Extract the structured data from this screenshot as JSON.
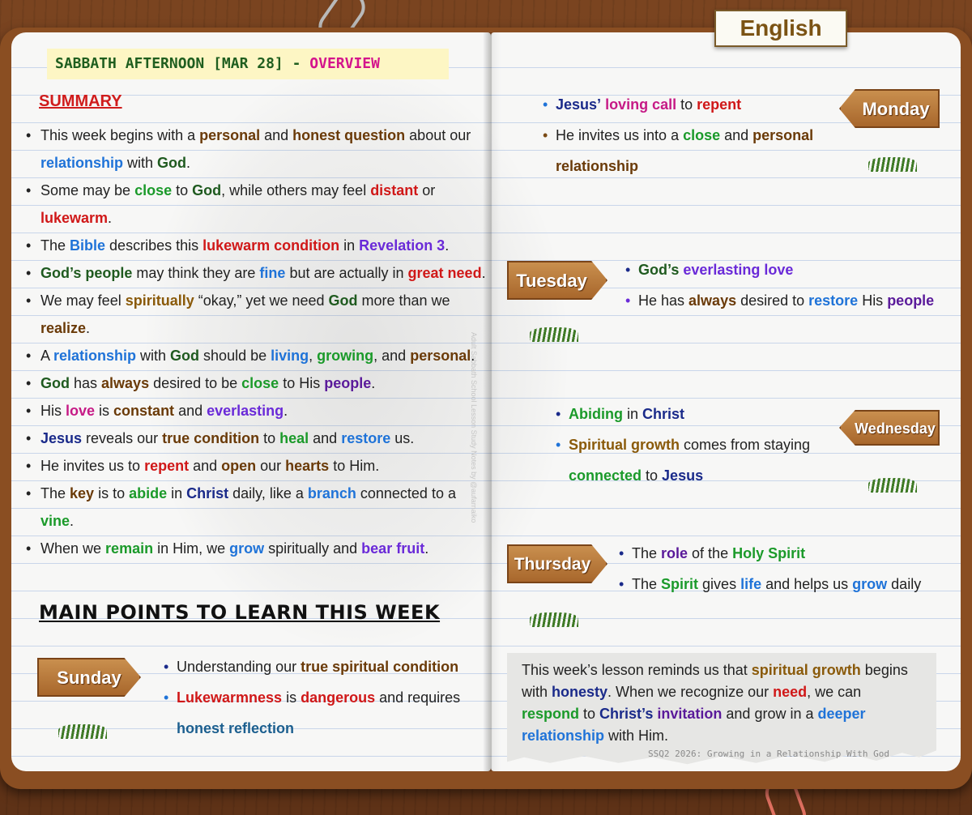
{
  "language_tab": "English",
  "header": {
    "part1": "SABBATH AFTERNOON [MAR 28] - ",
    "part2": "OVERVIEW"
  },
  "summary": {
    "title": "SUMMARY",
    "items": [
      [
        "This week begins with a ",
        {
          "t": "personal",
          "c": "brown"
        },
        " and ",
        {
          "t": "honest question",
          "c": "brown"
        },
        " about our ",
        {
          "t": "relationship",
          "c": "blue"
        },
        " with ",
        {
          "t": "God",
          "c": "dgreen"
        },
        "."
      ],
      [
        "Some may be ",
        {
          "t": "close",
          "c": "green"
        },
        " to ",
        {
          "t": "God",
          "c": "dgreen"
        },
        ", while others may feel ",
        {
          "t": "distant",
          "c": "red"
        },
        " or ",
        {
          "t": "lukewarm",
          "c": "red"
        },
        "."
      ],
      [
        "The ",
        {
          "t": "Bible",
          "c": "blue"
        },
        " describes this ",
        {
          "t": "lukewarm condition",
          "c": "red"
        },
        " in ",
        {
          "t": "Revelation 3",
          "c": "purple"
        },
        "."
      ],
      [
        {
          "t": "God’s people",
          "c": "dgreen"
        },
        " may think they are ",
        {
          "t": "fine",
          "c": "blue"
        },
        " but are actually in ",
        {
          "t": "great need",
          "c": "red"
        },
        "."
      ],
      [
        "We may feel ",
        {
          "t": "spiritually",
          "c": "gold"
        },
        " “okay,” yet we need ",
        {
          "t": "God",
          "c": "dgreen"
        },
        " more than we ",
        {
          "t": "realize",
          "c": "brown"
        },
        "."
      ],
      [
        "A ",
        {
          "t": "relationship",
          "c": "blue"
        },
        " with ",
        {
          "t": "God",
          "c": "dgreen"
        },
        " should be ",
        {
          "t": "living",
          "c": "blue"
        },
        ", ",
        {
          "t": "growing",
          "c": "green"
        },
        ", and ",
        {
          "t": "personal",
          "c": "brown"
        },
        "."
      ],
      [
        {
          "t": "God",
          "c": "dgreen"
        },
        " has ",
        {
          "t": "always",
          "c": "brown"
        },
        " desired to be ",
        {
          "t": "close",
          "c": "green"
        },
        " to His ",
        {
          "t": "people",
          "c": "dpurple"
        },
        "."
      ],
      [
        "His ",
        {
          "t": "love",
          "c": "magenta"
        },
        " is ",
        {
          "t": "constant",
          "c": "brown"
        },
        " and ",
        {
          "t": "everlasting",
          "c": "purple"
        },
        "."
      ],
      [
        {
          "t": "Jesus",
          "c": "navy"
        },
        " reveals our ",
        {
          "t": "true condition",
          "c": "brown"
        },
        " to ",
        {
          "t": "heal",
          "c": "green"
        },
        " and ",
        {
          "t": "restore",
          "c": "blue"
        },
        " us."
      ],
      [
        "He invites us to ",
        {
          "t": "repent",
          "c": "red"
        },
        " and ",
        {
          "t": "open",
          "c": "brown"
        },
        " our ",
        {
          "t": "hearts",
          "c": "brown"
        },
        " to Him."
      ],
      [
        "The ",
        {
          "t": "key",
          "c": "brown"
        },
        " is to ",
        {
          "t": "abide",
          "c": "green"
        },
        " in ",
        {
          "t": "Christ",
          "c": "navy"
        },
        " daily, like a ",
        {
          "t": "branch",
          "c": "blue"
        },
        " connected to a ",
        {
          "t": "vine",
          "c": "green"
        },
        "."
      ],
      [
        "When we ",
        {
          "t": "remain",
          "c": "green"
        },
        " in Him, we ",
        {
          "t": "grow",
          "c": "blue"
        },
        " spiritually and ",
        {
          "t": "bear fruit",
          "c": "purple"
        },
        "."
      ]
    ]
  },
  "main_points_title": "MAIN POINTS TO LEARN THIS WEEK",
  "days": {
    "sunday": {
      "label": "Sunday",
      "items": [
        {
          "bullet": "navy",
          "parts": [
            "Understanding our ",
            {
              "t": "true spiritual condition",
              "c": "brown"
            }
          ]
        },
        {
          "bullet": "blue",
          "parts": [
            {
              "t": "Lukewarmness",
              "c": "red"
            },
            " is ",
            {
              "t": "dangerous",
              "c": "red"
            },
            " and requires ",
            {
              "t": "honest reflection",
              "c": "teal"
            }
          ]
        }
      ]
    },
    "monday": {
      "label": "Monday",
      "items": [
        {
          "bullet": "blue",
          "parts": [
            {
              "t": "Jesus’",
              "c": "navy"
            },
            " ",
            {
              "t": "loving call",
              "c": "magenta"
            },
            " to ",
            {
              "t": "repent",
              "c": "red"
            }
          ]
        },
        {
          "bullet": "brown",
          "parts": [
            "He invites us into a ",
            {
              "t": "close",
              "c": "green"
            },
            " and ",
            {
              "t": "personal relationship",
              "c": "brown"
            }
          ]
        }
      ]
    },
    "tuesday": {
      "label": "Tuesday",
      "items": [
        {
          "bullet": "navy",
          "parts": [
            {
              "t": "God’s",
              "c": "dgreen"
            },
            " ",
            {
              "t": "everlasting love",
              "c": "purple"
            }
          ]
        },
        {
          "bullet": "purple",
          "parts": [
            "He has ",
            {
              "t": "always",
              "c": "brown"
            },
            " desired to ",
            {
              "t": "restore",
              "c": "blue"
            },
            " His ",
            {
              "t": "people",
              "c": "dpurple"
            }
          ]
        }
      ]
    },
    "wednesday": {
      "label": "Wednesday",
      "items": [
        {
          "bullet": "navy",
          "parts": [
            {
              "t": "Abiding",
              "c": "green"
            },
            " in ",
            {
              "t": "Christ",
              "c": "navy"
            }
          ]
        },
        {
          "bullet": "blue",
          "parts": [
            {
              "t": "Spiritual growth",
              "c": "gold"
            },
            " comes from staying ",
            {
              "t": "connected",
              "c": "green"
            },
            " to ",
            {
              "t": "Jesus",
              "c": "navy"
            }
          ]
        }
      ]
    },
    "thursday": {
      "label": "Thursday",
      "items": [
        {
          "bullet": "navy",
          "parts": [
            "The ",
            {
              "t": "role",
              "c": "dpurple"
            },
            " of the ",
            {
              "t": "Holy Spirit",
              "c": "green"
            }
          ]
        },
        {
          "bullet": "navy",
          "parts": [
            "The ",
            {
              "t": "Spirit",
              "c": "green"
            },
            " gives ",
            {
              "t": "life",
              "c": "blue"
            },
            " and helps us ",
            {
              "t": "grow",
              "c": "blue"
            },
            " daily"
          ]
        }
      ]
    }
  },
  "conclusion": [
    "This week’s lesson reminds us that ",
    {
      "t": "spiritual growth",
      "c": "gold"
    },
    " begins with ",
    {
      "t": "honesty",
      "c": "navy"
    },
    ". When we recognize our ",
    {
      "t": "need",
      "c": "red"
    },
    ", we can ",
    {
      "t": "respond",
      "c": "green"
    },
    " to ",
    {
      "t": "Christ’s",
      "c": "navy"
    },
    " ",
    {
      "t": "invitation",
      "c": "dpurple"
    },
    " and grow in a ",
    {
      "t": "deeper relationship",
      "c": "blue"
    },
    " with Him."
  ],
  "footer_credit": "SSQ2 2026: Growing in a Relationship With God",
  "side_credit": "Adult Sabbath School Lesson Study Notes by @aufarnaiko",
  "colors": {
    "brown": "#6a3a08",
    "blue": "#1f73d8",
    "dgreen": "#1f5a1f",
    "green": "#1b9a2a",
    "red": "#d01818",
    "purple": "#6a2ad8",
    "navy": "#1a2a8a",
    "gold": "#8a5a0a",
    "teal": "#1c5f8f",
    "magenta": "#c61a86",
    "dpurple": "#5a1a9a"
  }
}
